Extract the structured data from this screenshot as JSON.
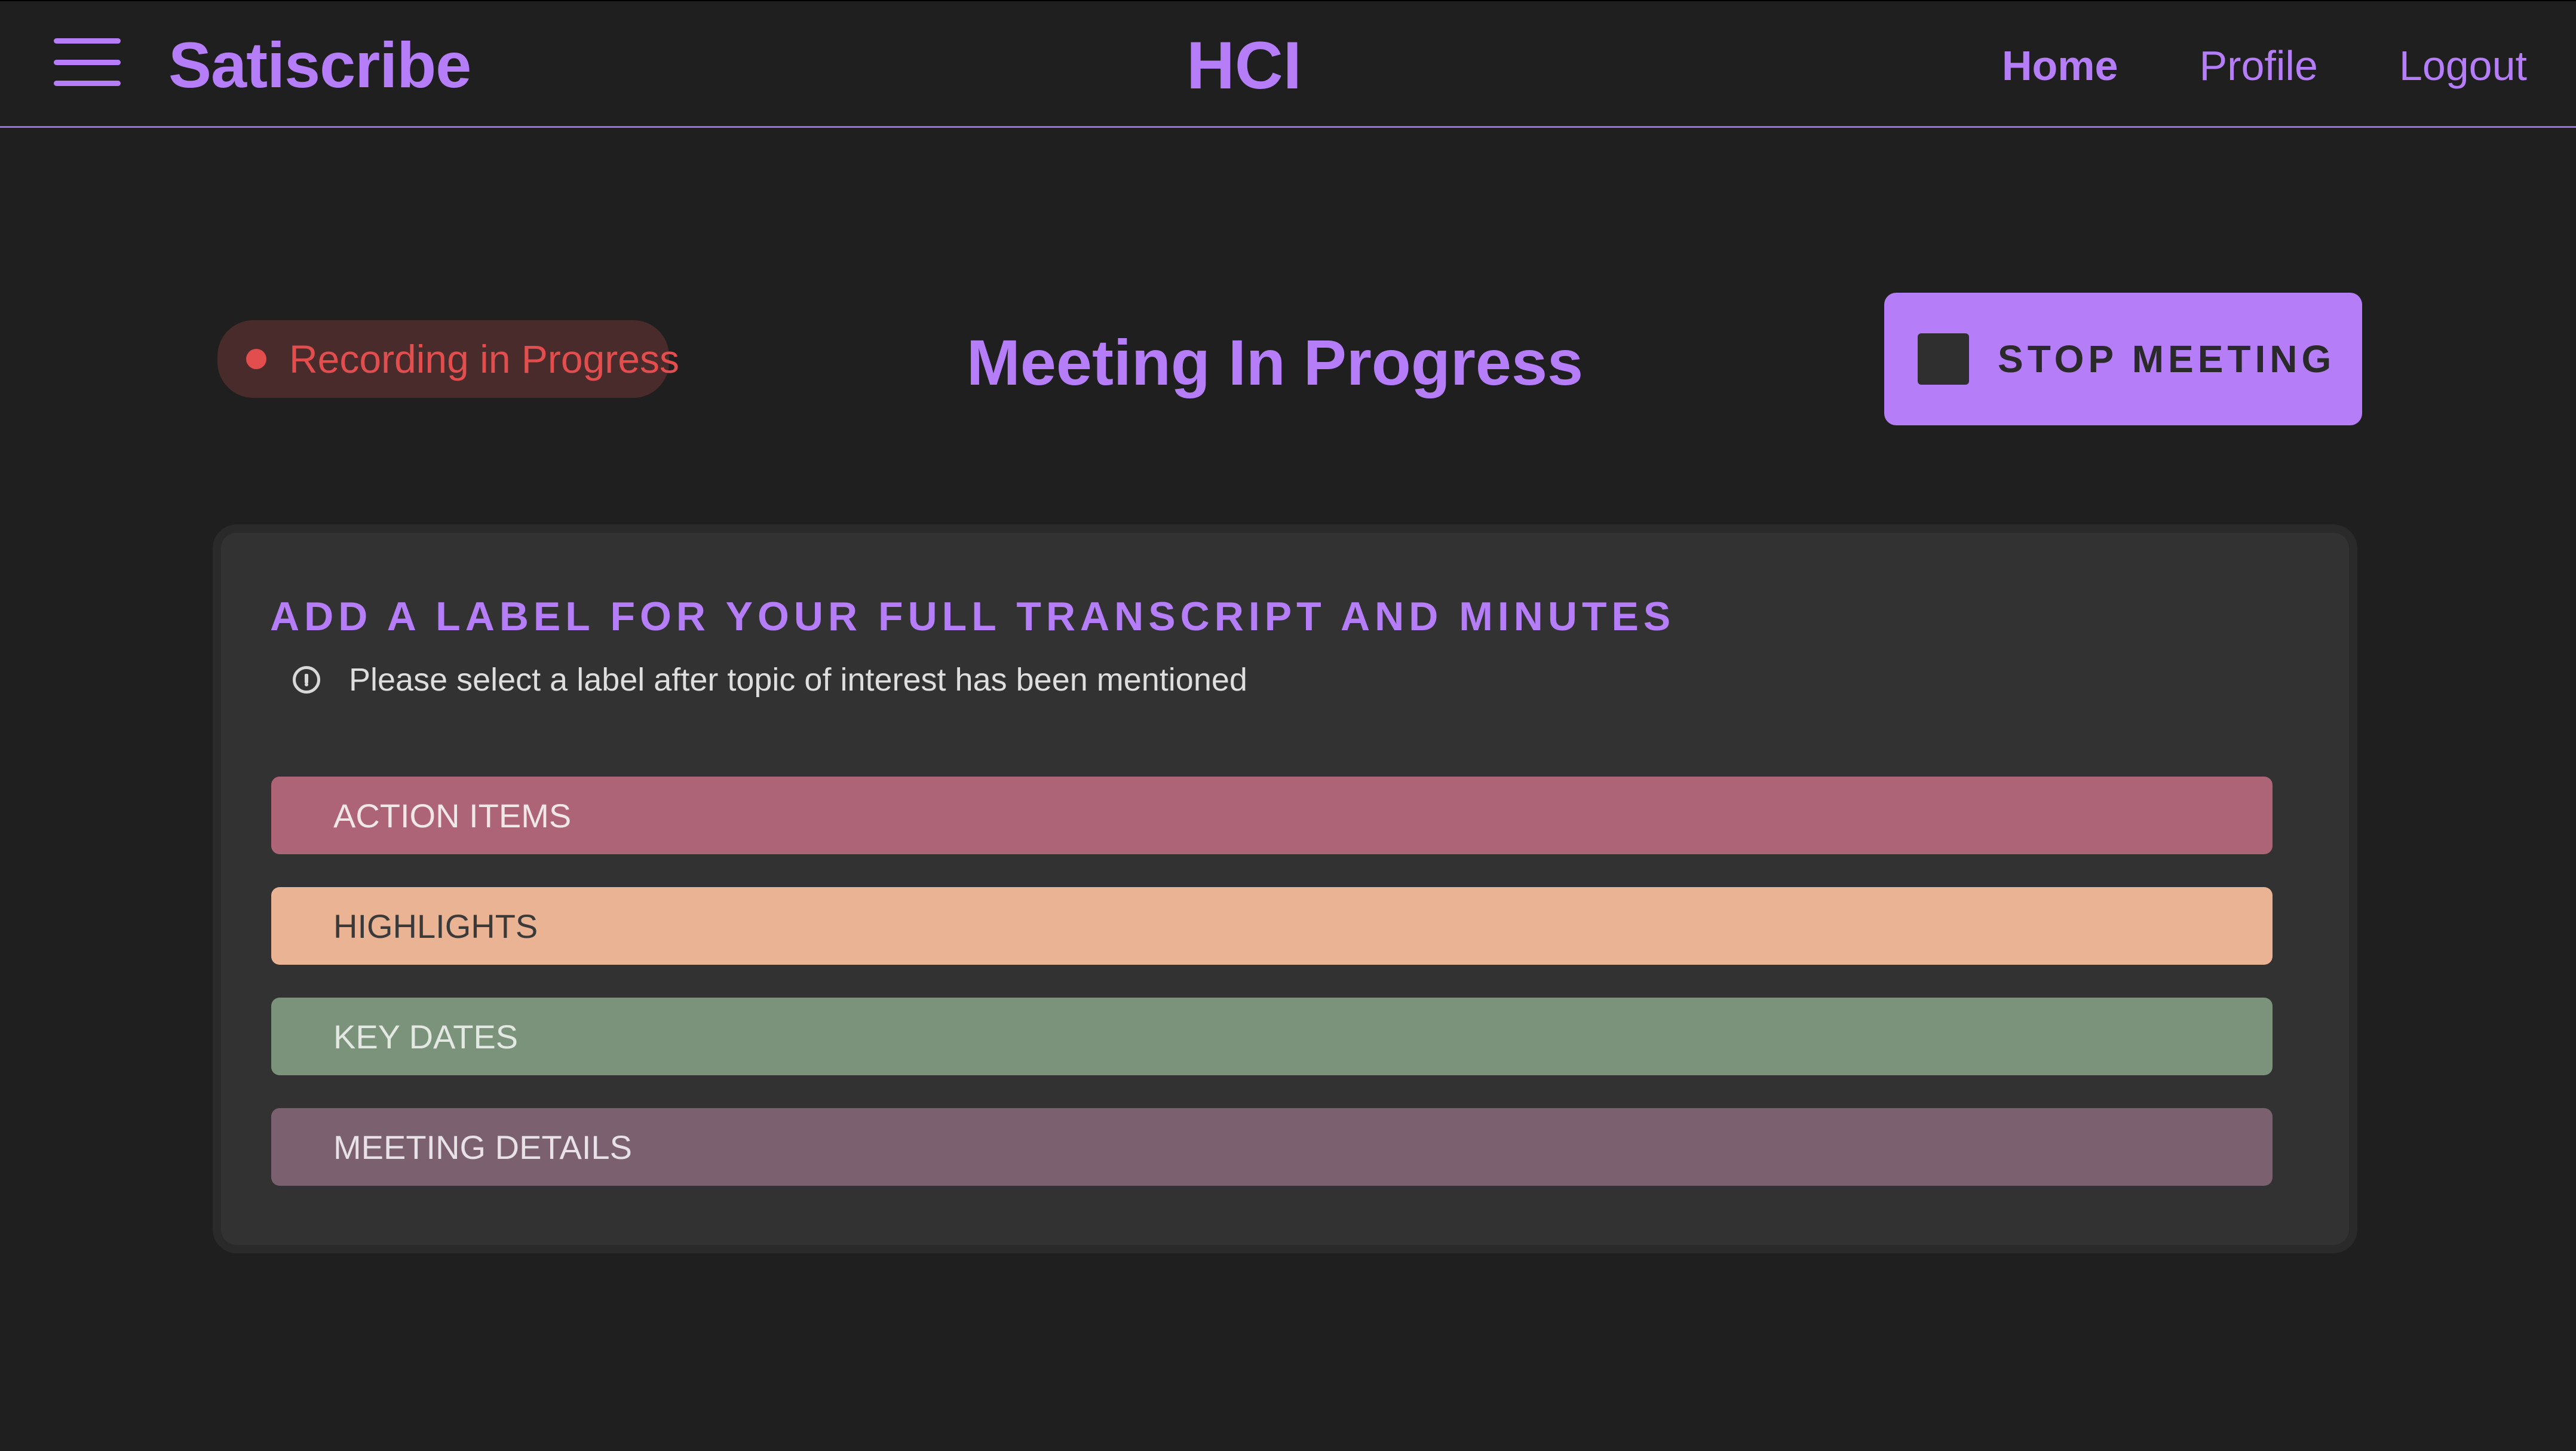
{
  "header": {
    "brand": "Satiscribe",
    "center_title": "HCI",
    "nav": [
      {
        "label": "Home",
        "active": true
      },
      {
        "label": "Profile",
        "active": false
      },
      {
        "label": "Logout",
        "active": false
      }
    ]
  },
  "status": {
    "recording_label": "Recording in Progress",
    "page_title": "Meeting In Progress",
    "stop_button_label": "STOP MEETING"
  },
  "card": {
    "title": "ADD A LABEL FOR YOUR FULL TRANSCRIPT AND MINUTES",
    "hint": "Please select a label after topic of interest has been mentioned",
    "labels": [
      {
        "label": "ACTION ITEMS",
        "color": "#ad6476"
      },
      {
        "label": "HIGHLIGHTS",
        "color": "#e9b394"
      },
      {
        "label": "KEY DATES",
        "color": "#7b927b"
      },
      {
        "label": "MEETING DETAILS",
        "color": "#7b6070"
      }
    ]
  },
  "colors": {
    "accent": "#b57ef8",
    "background": "#1f1f1f",
    "recording": "#e24d4d"
  }
}
